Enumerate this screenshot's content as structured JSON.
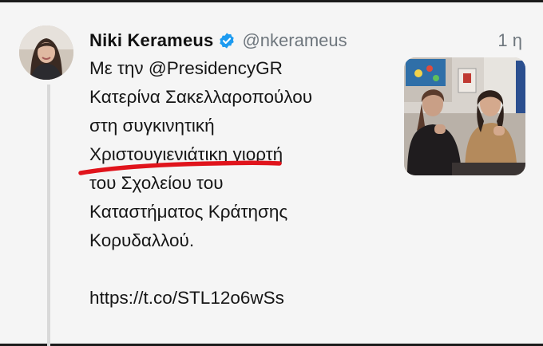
{
  "tweet": {
    "author": {
      "display_name": "Niki Kerameus",
      "handle": "@nkerameus",
      "verified_icon": "verified-badge-icon",
      "avatar_icon": "avatar-photo"
    },
    "timestamp": "1 η",
    "text_lines": [
      "Με την @PresidencyGR",
      "Κατερίνα Σακελλαροπούλου",
      "στη συγκινητική",
      "Χριστουγιενιάτικη γιορτή",
      "του Σχολείου του",
      "Καταστήματος Κράτησης",
      "Κορυδαλλού."
    ],
    "link": "https://t.co/STL12o6wSs",
    "media_icon": "attached-photo",
    "highlight_color": "#e0141c",
    "accent_color": "#1d9bf0"
  }
}
